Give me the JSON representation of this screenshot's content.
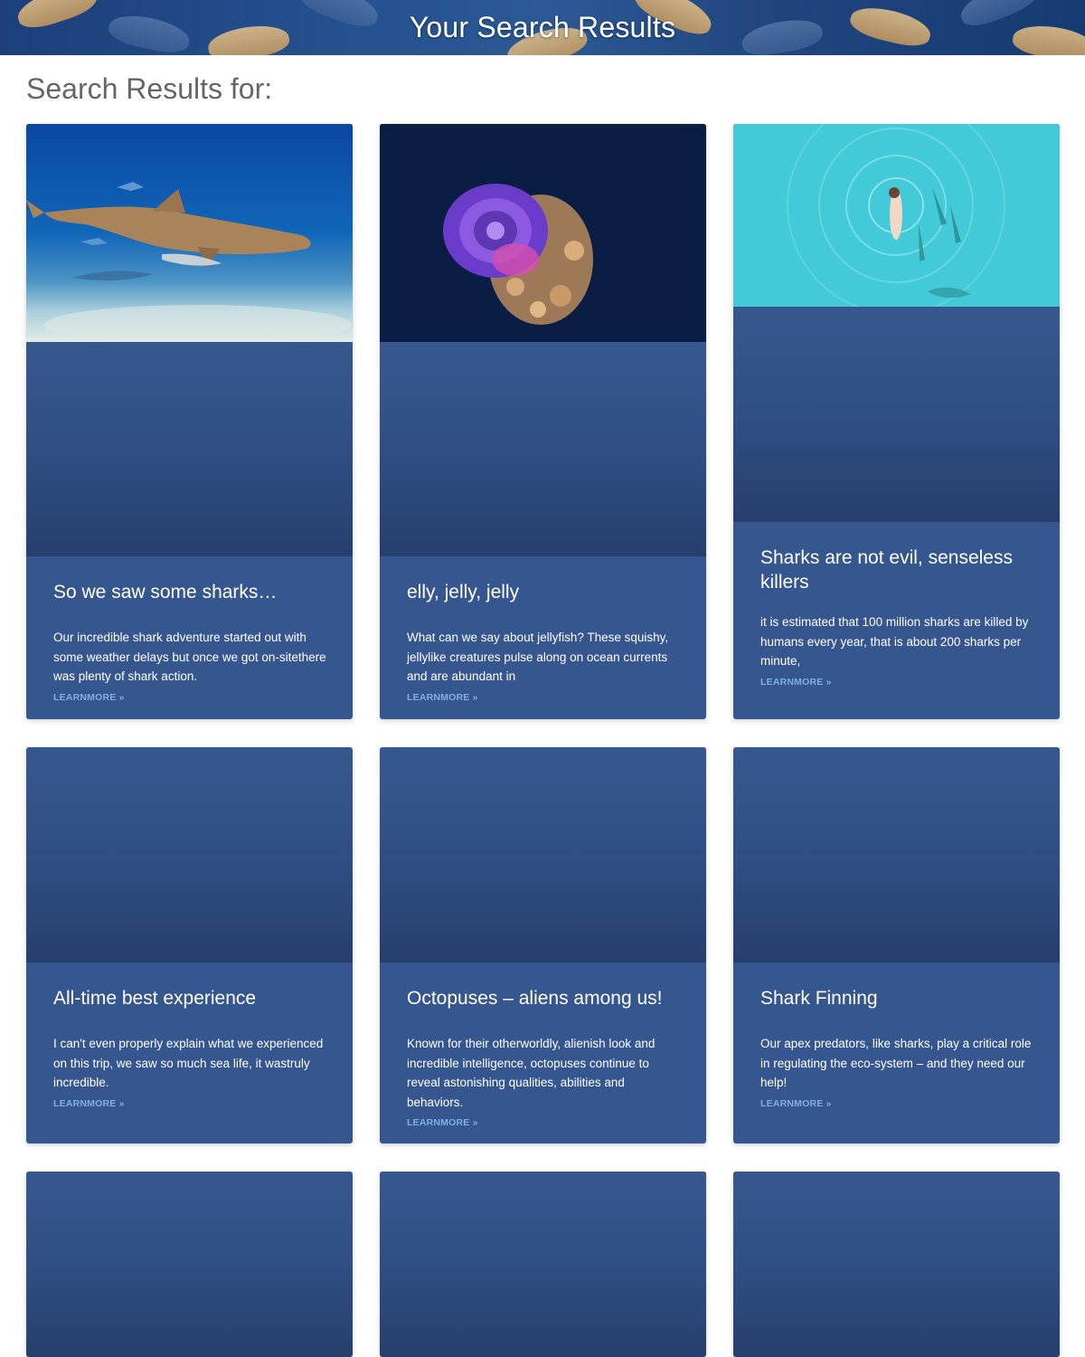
{
  "banner": {
    "title": "Your Search Results"
  },
  "heading": "Search Results for:",
  "cards": [
    {
      "title": "So we saw some sharks…",
      "excerpt": "Our incredible shark adventure started out with some weather delays but once we got on-sitethere was plenty of shark action.",
      "more": "LEARNMORE »",
      "image": "nurse-shark-photo"
    },
    {
      "title": "elly, jelly, jelly",
      "excerpt": "What can we say about jellyfish? These squishy, jellylike creatures pulse along on ocean currents and are abundant in",
      "more": "LEARNMORE »",
      "image": "jellyfish-photo"
    },
    {
      "title": "Sharks are not evil, senseless killers",
      "excerpt": "it is estimated that 100 million sharks are killed by humans every year, that is about 200 sharks per minute,",
      "more": "LEARNMORE »",
      "image": "swimmer-with-sharks-photo"
    },
    {
      "title": "All-time best experience",
      "excerpt": "I can't even properly explain what we experienced on this trip, we saw so much sea life, it wastruly incredible.",
      "more": "LEARNMORE »"
    },
    {
      "title": "Octopuses – aliens among us!",
      "excerpt": "Known for their otherworldly, alienish look and incredible intelligence, octopuses continue to reveal astonishing qualities, abilities and behaviors.",
      "more": "LEARNMORE »"
    },
    {
      "title": "Shark Finning",
      "excerpt": "Our apex predators, like sharks, play a critical role in regulating the eco-system – and they need our help!",
      "more": "LEARNMORE »"
    }
  ],
  "colors": {
    "card_background": "#36568f",
    "link": "#7fb0e2",
    "heading": "#666666"
  }
}
